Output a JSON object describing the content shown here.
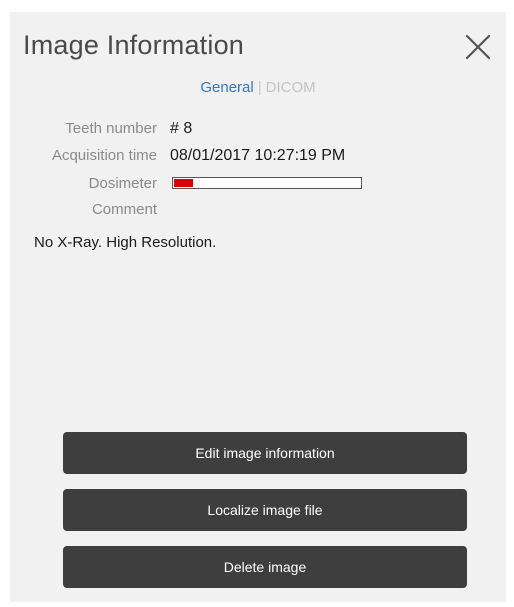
{
  "dialog": {
    "title": "Image Information",
    "close_icon": "close-icon"
  },
  "tabs": {
    "general": "General",
    "separator": "|",
    "dicom": "DICOM",
    "active": "General"
  },
  "fields": {
    "teeth_number_label": "Teeth number",
    "teeth_number_value": "# 8",
    "acquisition_time_label": "Acquisition time",
    "acquisition_time_value": "08/01/2017 10:27:19 PM",
    "dosimeter_label": "Dosimeter",
    "dosimeter_level": 0.1,
    "dosimeter_color": "#e00000",
    "comment_label": "Comment",
    "comment_value": "No X-Ray. High Resolution."
  },
  "actions": {
    "edit_label": "Edit image information",
    "localize_label": "Localize image file",
    "delete_label": "Delete image"
  }
}
